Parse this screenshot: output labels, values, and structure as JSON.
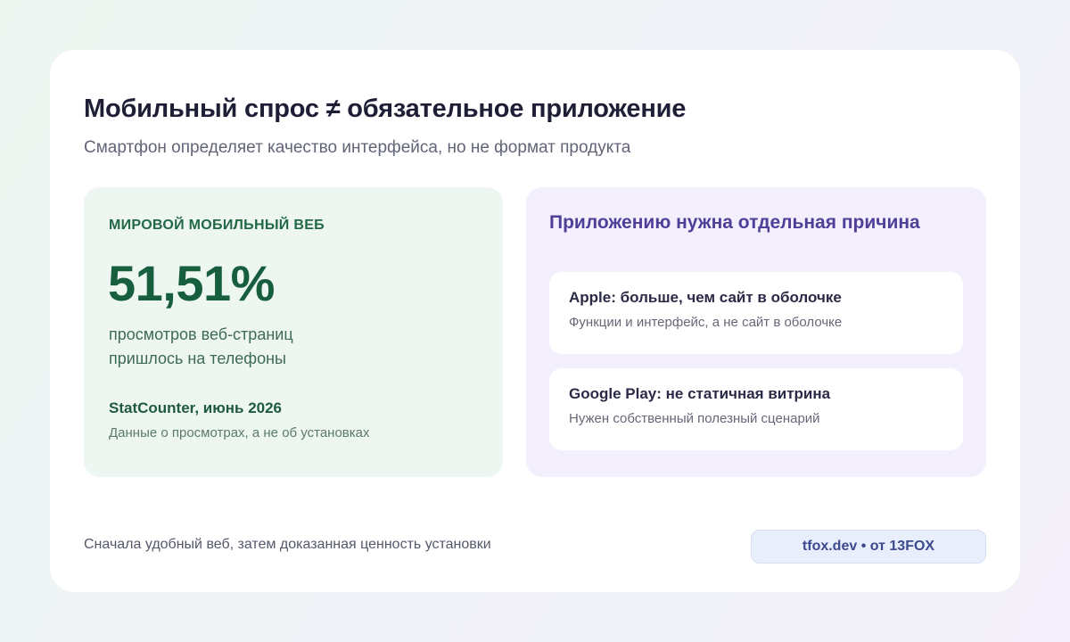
{
  "header": {
    "title": "Мобильный спрос ≠ обязательное приложение",
    "subtitle": "Смартфон определяет качество интерфейса, но не формат продукта"
  },
  "stat_panel": {
    "eyebrow": "МИРОВОЙ МОБИЛЬНЫЙ ВЕБ",
    "value": "51,51%",
    "description_line1": "просмотров веб-страниц",
    "description_line2": "пришлось на телефоны",
    "source": "StatCounter, июнь 2026",
    "source_note": "Данные о просмотрах, а не об установках"
  },
  "reasons_panel": {
    "title": "Приложению нужна отдельная причина",
    "items": [
      {
        "title": "Apple: больше, чем сайт в оболочке",
        "description": "Функции и интерфейс, а не сайт в оболочке"
      },
      {
        "title": "Google Play: не статичная витрина",
        "description": "Нужен собственный полезный сценарий"
      }
    ]
  },
  "footer": {
    "note": "Сначала удобный веб, затем доказанная ценность установки",
    "brand": "tfox.dev • от 13FOX"
  },
  "colors": {
    "stat_accent": "#175e3f",
    "reasons_accent": "#4f3f98",
    "brand_text": "#3b4a8e"
  }
}
